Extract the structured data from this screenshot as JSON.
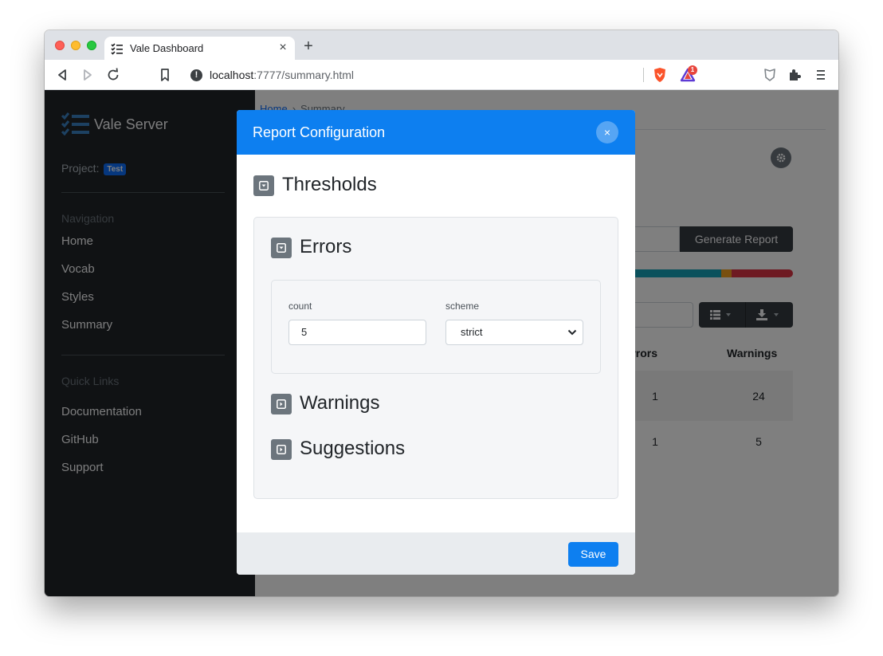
{
  "browser": {
    "tab_title": "Vale Dashboard",
    "url_host": "localhost",
    "url_rest": ":7777/summary.html",
    "rewards_badge": "1"
  },
  "sidebar": {
    "brand": "Vale Server",
    "project_label": "Project:",
    "project_badge": "Test",
    "nav_heading": "Navigation",
    "nav_items": [
      "Home",
      "Vocab",
      "Styles",
      "Summary"
    ],
    "links_heading": "Quick Links",
    "link_items": [
      "Documentation",
      "GitHub",
      "Support"
    ]
  },
  "main": {
    "breadcrumb": [
      "Home",
      "Summary"
    ],
    "generate_button": "Generate Report",
    "table": {
      "headers": [
        "Errors",
        "Warnings"
      ],
      "rows": [
        {
          "errors": "1",
          "warnings": "24"
        },
        {
          "errors": "1",
          "warnings": "5"
        }
      ]
    },
    "progress": [
      {
        "color": "#17a2b8",
        "value": 0.86
      },
      {
        "color": "#f0a020",
        "value": 0.02
      },
      {
        "color": "#dc3545",
        "value": 0.12
      }
    ]
  },
  "modal": {
    "title": "Report Configuration",
    "close": "×",
    "thresholds_title": "Thresholds",
    "errors": {
      "title": "Errors",
      "count_label": "count",
      "count_value": "5",
      "scheme_label": "scheme",
      "scheme_value": "strict"
    },
    "warnings_title": "Warnings",
    "suggestions_title": "Suggestions",
    "save_label": "Save"
  },
  "colors": {
    "modal_header": "#0d7ff0",
    "sidebar": "#212529"
  }
}
